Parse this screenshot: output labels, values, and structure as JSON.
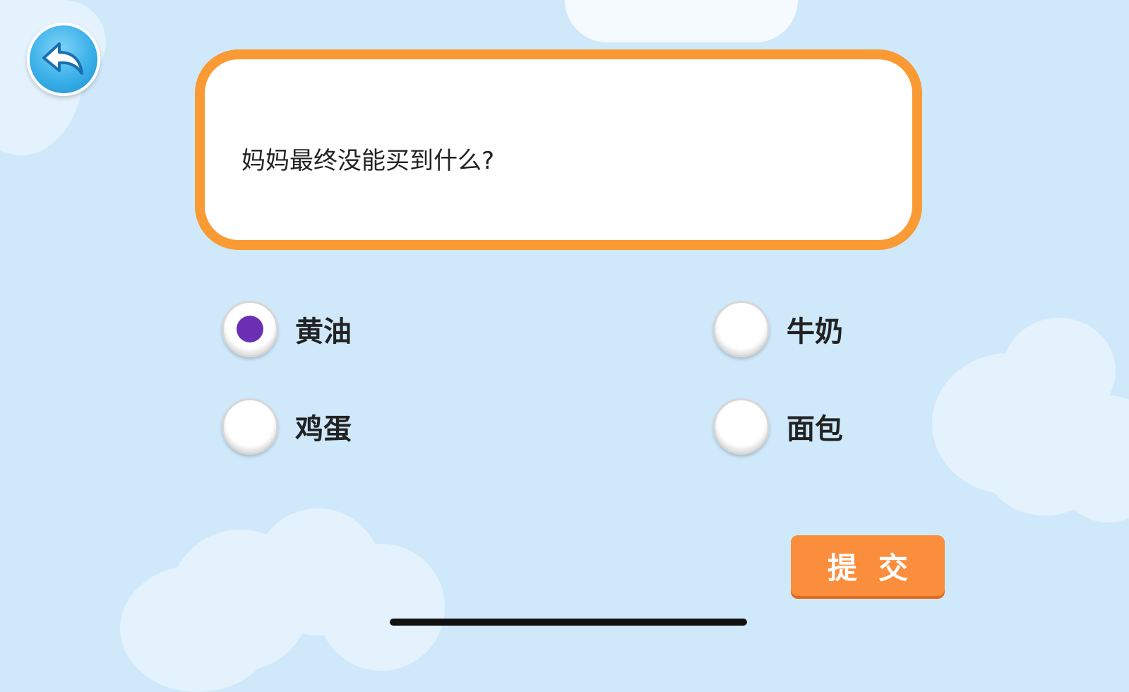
{
  "question": {
    "text": "妈妈最终没能买到什么?"
  },
  "options": [
    {
      "label": "黄油",
      "selected": true
    },
    {
      "label": "牛奶",
      "selected": false
    },
    {
      "label": "鸡蛋",
      "selected": false
    },
    {
      "label": "面包",
      "selected": false
    }
  ],
  "submit": {
    "label": "提交"
  },
  "colors": {
    "background": "#cfe9fb",
    "accent_orange": "#fa9a35",
    "selected_dot": "#6a2fb2",
    "back_button": "#3ab0e8"
  },
  "icons": {
    "back": "back-arrow-icon"
  }
}
